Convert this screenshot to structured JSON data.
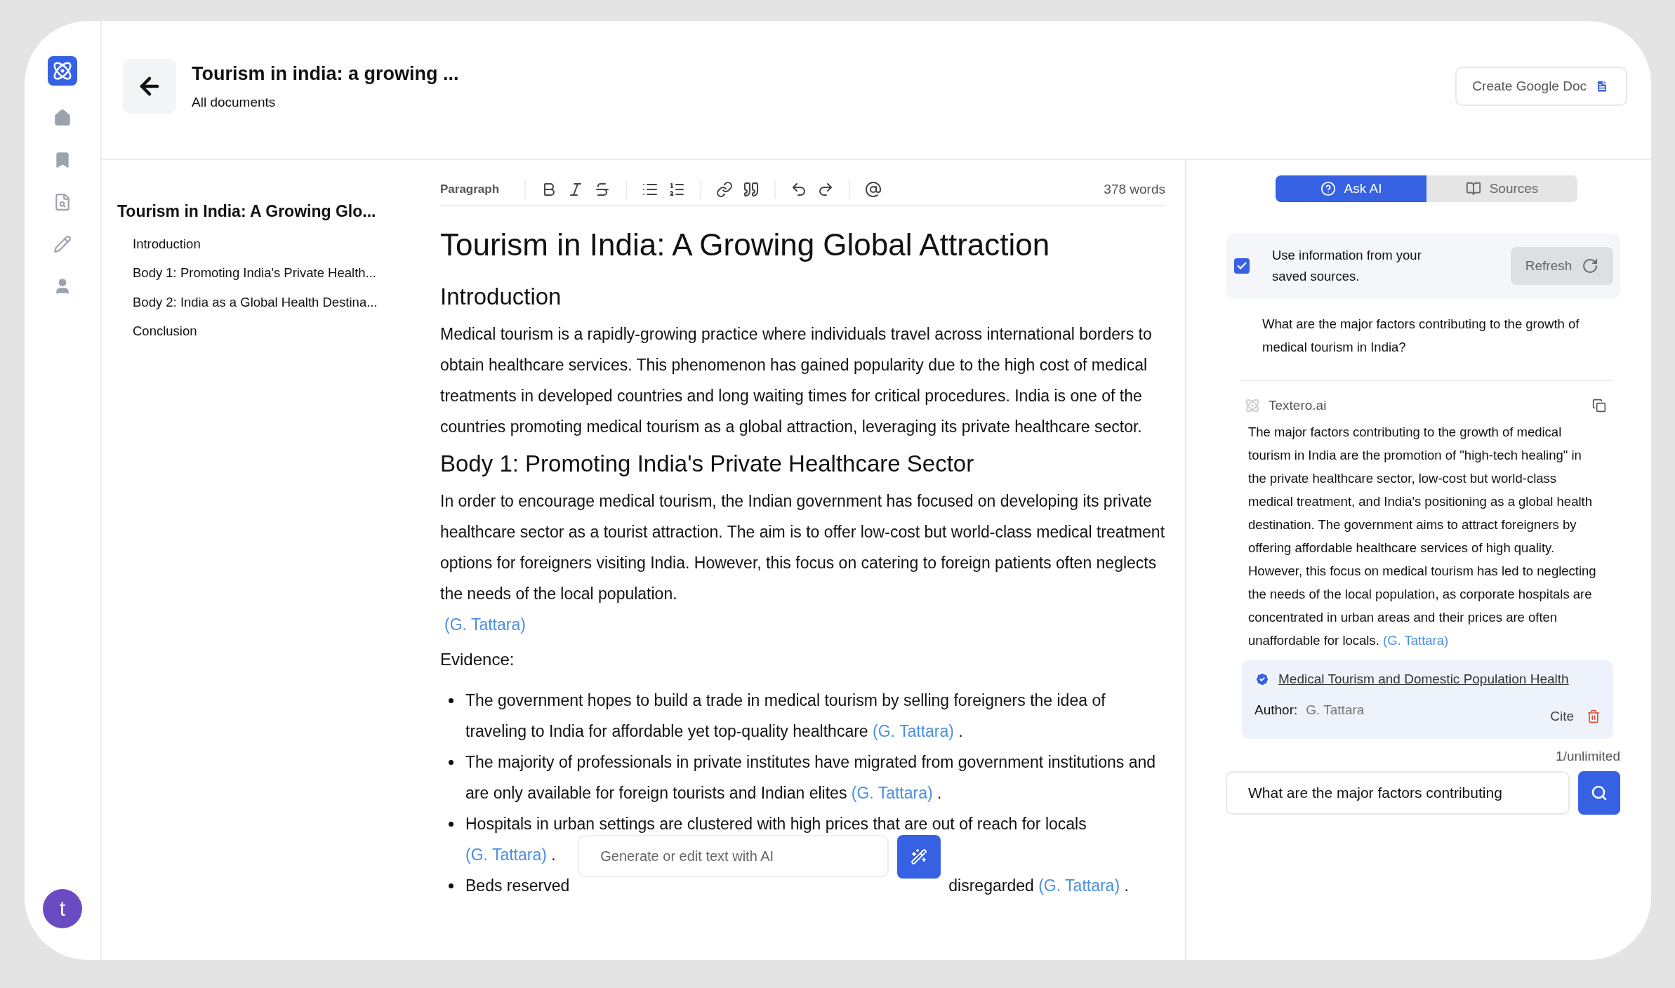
{
  "nav": {
    "avatar": "t"
  },
  "header": {
    "title": "Tourism in india: a growing ...",
    "subtitle": "All documents",
    "action": "Create Google Doc"
  },
  "outline": {
    "title": "Tourism in India: A Growing Glo...",
    "items": [
      "Introduction",
      "Body 1: Promoting India's Private Health...",
      "Body 2: India as a Global Health Destina...",
      "Conclusion"
    ]
  },
  "toolbar": {
    "block_type": "Paragraph",
    "word_count": "378 words"
  },
  "document": {
    "title": "Tourism in India: A Growing Global Attraction",
    "blocks": [
      {
        "kind": "heading",
        "text": "Introduction"
      },
      {
        "kind": "paragraph",
        "text": "Medical tourism is a rapidly-growing practice where individuals travel across international borders to obtain healthcare services. This phenomenon has gained popularity due to the high cost of medical treatments in developed countries and long waiting times for critical procedures. India is one of the countries promoting medical tourism as a global attraction, leveraging its private healthcare sector."
      },
      {
        "kind": "heading",
        "text": "Body 1: Promoting India's Private Healthcare Sector"
      },
      {
        "kind": "paragraph",
        "text": "In order to encourage medical tourism, the Indian government has focused on developing its private healthcare sector as a tourist attraction. The aim is to offer low-cost but world-class medical treatment options for foreigners visiting India. However, this focus on catering to foreign patients often neglects the needs of the local population."
      },
      {
        "kind": "citation",
        "text": "(G. Tattara)"
      },
      {
        "kind": "label",
        "text": "Evidence:"
      },
      {
        "kind": "bullets",
        "items": [
          {
            "text": "The government hopes to build a trade in medical tourism by selling foreigners the idea of traveling to India for affordable yet top-quality healthcare",
            "cite": "(G. Tattara)",
            "end": "."
          },
          {
            "text": "The majority of professionals in private institutes have migrated from government institutions and are only available for foreign tourists and Indian elites",
            "cite": "(G. Tattara)",
            "end": "."
          },
          {
            "text": "Hospitals in urban settings are clustered with high prices that are out of reach for locals",
            "cite": "(G. Tattara)",
            "end": "."
          },
          {
            "text": "Beds reserved",
            "text_after": "disregarded",
            "cite": "(G. Tattara)",
            "end": "."
          }
        ]
      }
    ]
  },
  "ai_prompt": {
    "placeholder": "Generate or edit text with AI"
  },
  "panel": {
    "tabs": [
      {
        "label": "Ask AI",
        "selected": true
      },
      {
        "label": "Sources",
        "selected": false
      }
    ],
    "sources_option": {
      "checked": true,
      "label": "Use information from your saved sources.",
      "button": "Refresh"
    },
    "question": "What are the major factors contributing to the growth of medical tourism in India?",
    "answer": {
      "author": "Textero.ai",
      "text": "The major factors contributing to the growth of medical tourism in India are the promotion of \"high-tech healing\" in the private healthcare sector, low-cost but world-class medical treatment, and India's positioning as a global health destination. The government aims to attract foreigners by offering affordable healthcare services of high quality. However, this focus on medical tourism has led to neglecting the needs of the local population, as corporate hospitals are concentrated in urban areas and their prices are often unaffordable for locals.",
      "cite": "(G. Tattara)"
    },
    "source": {
      "title": "Medical Tourism and Domestic Population Health",
      "author_label": "Author:",
      "author": "G. Tattara",
      "action": "Cite"
    },
    "usage": "1/unlimited",
    "input": {
      "value": "What are the major factors contributing"
    }
  }
}
